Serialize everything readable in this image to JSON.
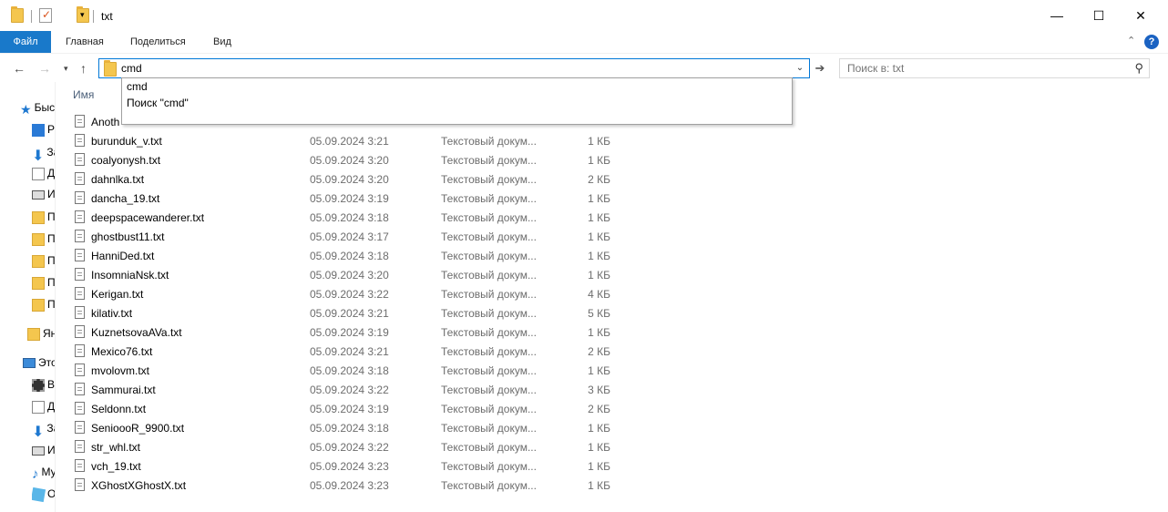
{
  "window": {
    "title": "txt",
    "controls": {
      "minimize": "—",
      "maximize": "☐",
      "close": "✕"
    }
  },
  "ribbon": {
    "tabs": [
      "Файл",
      "Главная",
      "Поделиться",
      "Вид"
    ],
    "help": "?"
  },
  "address": {
    "value": "cmd",
    "suggestions": [
      "cmd",
      "Поиск \"cmd\""
    ]
  },
  "search": {
    "placeholder": "Поиск в: txt"
  },
  "sidebar": {
    "items": [
      {
        "label": "Быстрый доступ",
        "icon": "star-icon"
      },
      {
        "label": "Рабочий стол",
        "icon": "desktop-icon"
      },
      {
        "label": "Загрузки",
        "icon": "download-icon"
      },
      {
        "label": "Документы",
        "icon": "document-icon"
      },
      {
        "label": "Изображения",
        "icon": "pictures-icon"
      },
      {
        "label": "Папка",
        "icon": "folder-icon"
      },
      {
        "label": "Папка",
        "icon": "folder-icon"
      },
      {
        "label": "Папка",
        "icon": "folder-icon"
      },
      {
        "label": "Папка",
        "icon": "folder-icon"
      },
      {
        "label": "Папка",
        "icon": "folder-icon"
      },
      {
        "label": "Яндекс",
        "icon": "folder-icon"
      },
      {
        "label": "Этот компьютер",
        "icon": "computer-icon"
      },
      {
        "label": "Видео",
        "icon": "video-icon"
      },
      {
        "label": "Документы",
        "icon": "document-icon"
      },
      {
        "label": "Загрузки",
        "icon": "download-icon"
      },
      {
        "label": "Изображения",
        "icon": "pictures-icon"
      },
      {
        "label": "Музыка",
        "icon": "music-icon"
      },
      {
        "label": "Объемные объекты",
        "icon": "3d-objects-icon"
      }
    ]
  },
  "file_list": {
    "columns": {
      "name": "Имя"
    },
    "rows": [
      {
        "name": "Anoth",
        "date": "",
        "type": "",
        "size": ""
      },
      {
        "name": "burunduk_v.txt",
        "date": "05.09.2024 3:21",
        "type": "Текстовый докум...",
        "size": "1 КБ"
      },
      {
        "name": "coalyonysh.txt",
        "date": "05.09.2024 3:20",
        "type": "Текстовый докум...",
        "size": "1 КБ"
      },
      {
        "name": "dahnlka.txt",
        "date": "05.09.2024 3:20",
        "type": "Текстовый докум...",
        "size": "2 КБ"
      },
      {
        "name": "dancha_19.txt",
        "date": "05.09.2024 3:19",
        "type": "Текстовый докум...",
        "size": "1 КБ"
      },
      {
        "name": "deepspacewanderer.txt",
        "date": "05.09.2024 3:18",
        "type": "Текстовый докум...",
        "size": "1 КБ"
      },
      {
        "name": "ghostbust11.txt",
        "date": "05.09.2024 3:17",
        "type": "Текстовый докум...",
        "size": "1 КБ"
      },
      {
        "name": "HanniDed.txt",
        "date": "05.09.2024 3:18",
        "type": "Текстовый докум...",
        "size": "1 КБ"
      },
      {
        "name": "InsomniaNsk.txt",
        "date": "05.09.2024 3:20",
        "type": "Текстовый докум...",
        "size": "1 КБ"
      },
      {
        "name": "Kerigan.txt",
        "date": "05.09.2024 3:22",
        "type": "Текстовый докум...",
        "size": "4 КБ"
      },
      {
        "name": "kilativ.txt",
        "date": "05.09.2024 3:21",
        "type": "Текстовый докум...",
        "size": "5 КБ"
      },
      {
        "name": "KuznetsovaAVa.txt",
        "date": "05.09.2024 3:19",
        "type": "Текстовый докум...",
        "size": "1 КБ"
      },
      {
        "name": "Mexico76.txt",
        "date": "05.09.2024 3:21",
        "type": "Текстовый докум...",
        "size": "2 КБ"
      },
      {
        "name": "mvolovm.txt",
        "date": "05.09.2024 3:18",
        "type": "Текстовый докум...",
        "size": "1 КБ"
      },
      {
        "name": "Sammurai.txt",
        "date": "05.09.2024 3:22",
        "type": "Текстовый докум...",
        "size": "3 КБ"
      },
      {
        "name": "Seldonn.txt",
        "date": "05.09.2024 3:19",
        "type": "Текстовый докум...",
        "size": "2 КБ"
      },
      {
        "name": "SenioooR_9900.txt",
        "date": "05.09.2024 3:18",
        "type": "Текстовый докум...",
        "size": "1 КБ"
      },
      {
        "name": "str_whl.txt",
        "date": "05.09.2024 3:22",
        "type": "Текстовый докум...",
        "size": "1 КБ"
      },
      {
        "name": "vch_19.txt",
        "date": "05.09.2024 3:23",
        "type": "Текстовый докум...",
        "size": "1 КБ"
      },
      {
        "name": "XGhostXGhostX.txt",
        "date": "05.09.2024 3:23",
        "type": "Текстовый докум...",
        "size": "1 КБ"
      }
    ]
  }
}
